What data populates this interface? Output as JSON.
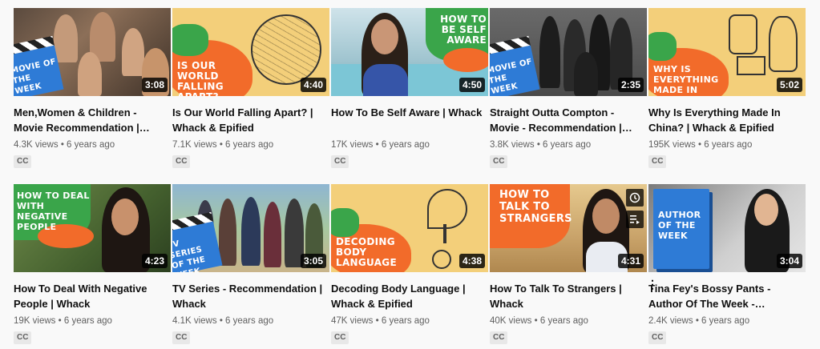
{
  "videos": [
    {
      "title": "Men,Women & Children - Movie Recommendation |…",
      "views": "4.3K views",
      "age": "6 years ago",
      "duration": "3:08",
      "badge": "CC",
      "thumb_text": "MOVIE OF THE WEEK"
    },
    {
      "title": "Is Our World Falling Apart? | Whack & Epified",
      "views": "7.1K views",
      "age": "6 years ago",
      "duration": "4:40",
      "badge": "CC",
      "thumb_text": "IS OUR WORLD FALLING APART?"
    },
    {
      "title": "How To Be Self Aware | Whack",
      "views": "17K views",
      "age": "6 years ago",
      "duration": "4:50",
      "badge": "CC",
      "thumb_text": "HOW TO BE SELF AWARE"
    },
    {
      "title": "Straight Outta Compton - Movie - Recommendation |…",
      "views": "3.8K views",
      "age": "6 years ago",
      "duration": "2:35",
      "badge": "CC",
      "thumb_text": "MOVIE OF THE WEEK"
    },
    {
      "title": "Why Is Everything Made In China? | Whack & Epified",
      "views": "195K views",
      "age": "6 years ago",
      "duration": "5:02",
      "badge": "CC",
      "thumb_text": "WHY IS EVERYTHING MADE IN CHINA?"
    },
    {
      "title": "How To Deal With Negative People | Whack",
      "views": "19K views",
      "age": "6 years ago",
      "duration": "4:23",
      "badge": "CC",
      "thumb_text": "HOW TO DEAL WITH NEGATIVE PEOPLE"
    },
    {
      "title": "TV Series - Recommendation | Whack",
      "views": "4.1K views",
      "age": "6 years ago",
      "duration": "3:05",
      "badge": "CC",
      "thumb_text": "TV SERIES OF THE WEEK"
    },
    {
      "title": "Decoding Body Language | Whack & Epified",
      "views": "47K views",
      "age": "6 years ago",
      "duration": "4:38",
      "badge": "CC",
      "thumb_text": "DECODING BODY LANGUAGE"
    },
    {
      "title": "How To Talk To Strangers | Whack",
      "views": "40K views",
      "age": "6 years ago",
      "duration": "4:31",
      "badge": "CC",
      "thumb_text": "HOW TO TALK TO STRANGERS"
    },
    {
      "title": "Tina Fey's Bossy Pants - Author Of The Week -…",
      "views": "2.4K views",
      "age": "6 years ago",
      "duration": "3:04",
      "badge": "CC",
      "thumb_text": "AUTHOR OF THE WEEK"
    }
  ],
  "separator": "•",
  "icons": {
    "watch_later": "clock-icon",
    "add_to_queue": "queue-icon",
    "menu": "more-vert-icon"
  },
  "colors": {
    "accent_blue": "#2e7bd6",
    "accent_orange": "#f26b2a",
    "accent_green": "#3aa54a",
    "paper": "#f7d88a"
  }
}
